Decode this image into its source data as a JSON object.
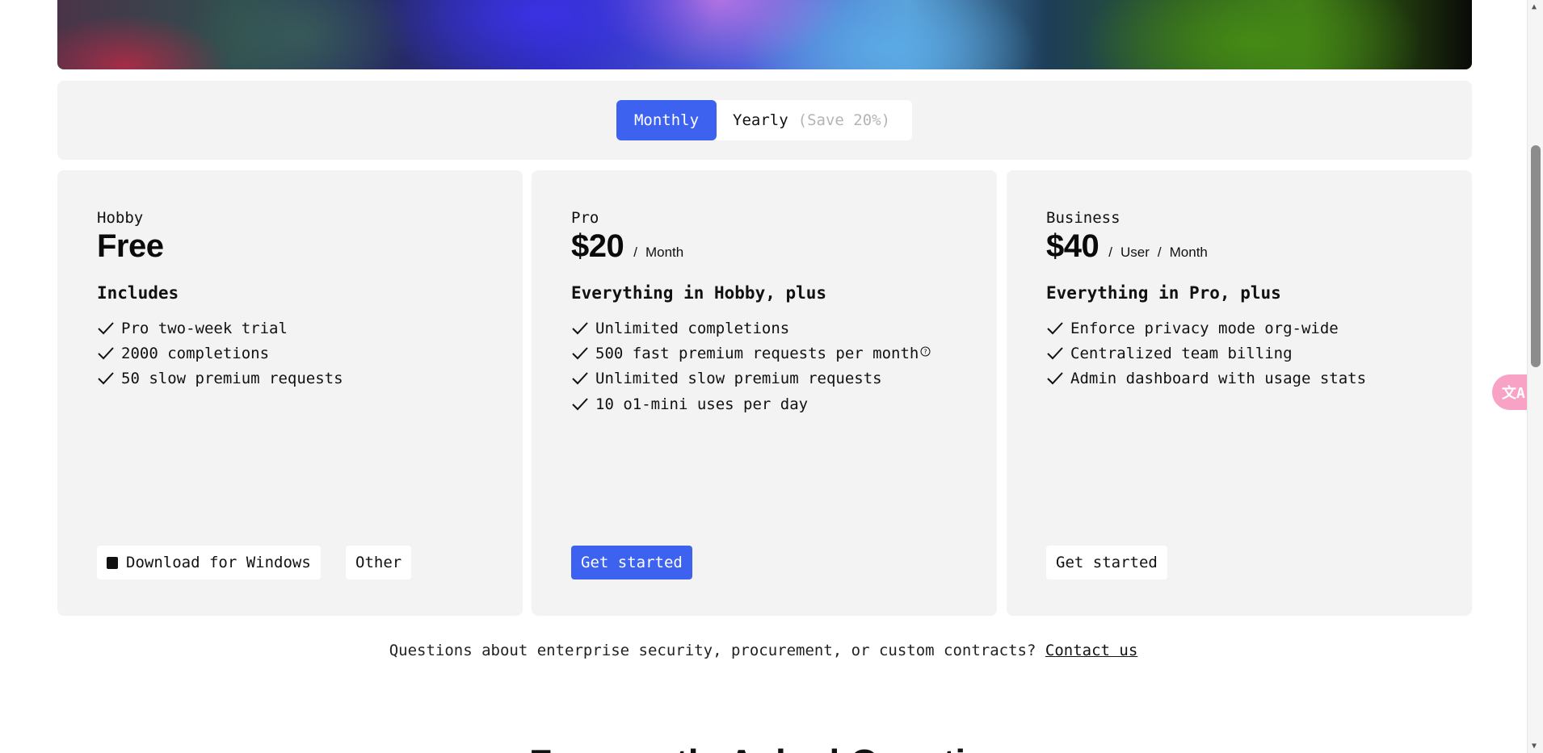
{
  "billing_toggle": {
    "monthly_label": "Monthly",
    "yearly_label": "Yearly",
    "yearly_savings": "(Save 20%)",
    "selected": "Monthly"
  },
  "plans": [
    {
      "name": "Hobby",
      "price": "Free",
      "features_title": "Includes",
      "features": [
        "Pro two-week trial",
        "2000 completions",
        "50 slow premium requests"
      ],
      "buttons": {
        "primary": "Download for Windows",
        "secondary": "Other"
      }
    },
    {
      "name": "Pro",
      "price": "$20",
      "unit": "Month",
      "features_title": "Everything in Hobby, plus",
      "features": [
        "Unlimited completions",
        "500 fast premium requests per month",
        "Unlimited slow premium requests",
        "10 o1-mini uses per day"
      ],
      "info_icon": "?",
      "buttons": {
        "primary": "Get started"
      }
    },
    {
      "name": "Business",
      "price": "$40",
      "unit_user": "User",
      "unit": "Month",
      "features_title": "Everything in Pro, plus",
      "features": [
        "Enforce privacy mode org-wide",
        "Centralized team billing",
        "Admin dashboard with usage stats"
      ],
      "buttons": {
        "primary": "Get started"
      }
    }
  ],
  "contact": {
    "text": "Questions about enterprise security, procurement, or custom contracts?",
    "link": "Contact us"
  },
  "next_section_heading": "Frequently Asked Questions",
  "translate_widget": {
    "icon": "translate-icon",
    "glyph": "文A"
  },
  "colors": {
    "accent": "#3d62f0",
    "card_bg": "#f3f3f3",
    "muted_text": "#b4b4b4",
    "translate_bg": "#f8a3c6"
  }
}
